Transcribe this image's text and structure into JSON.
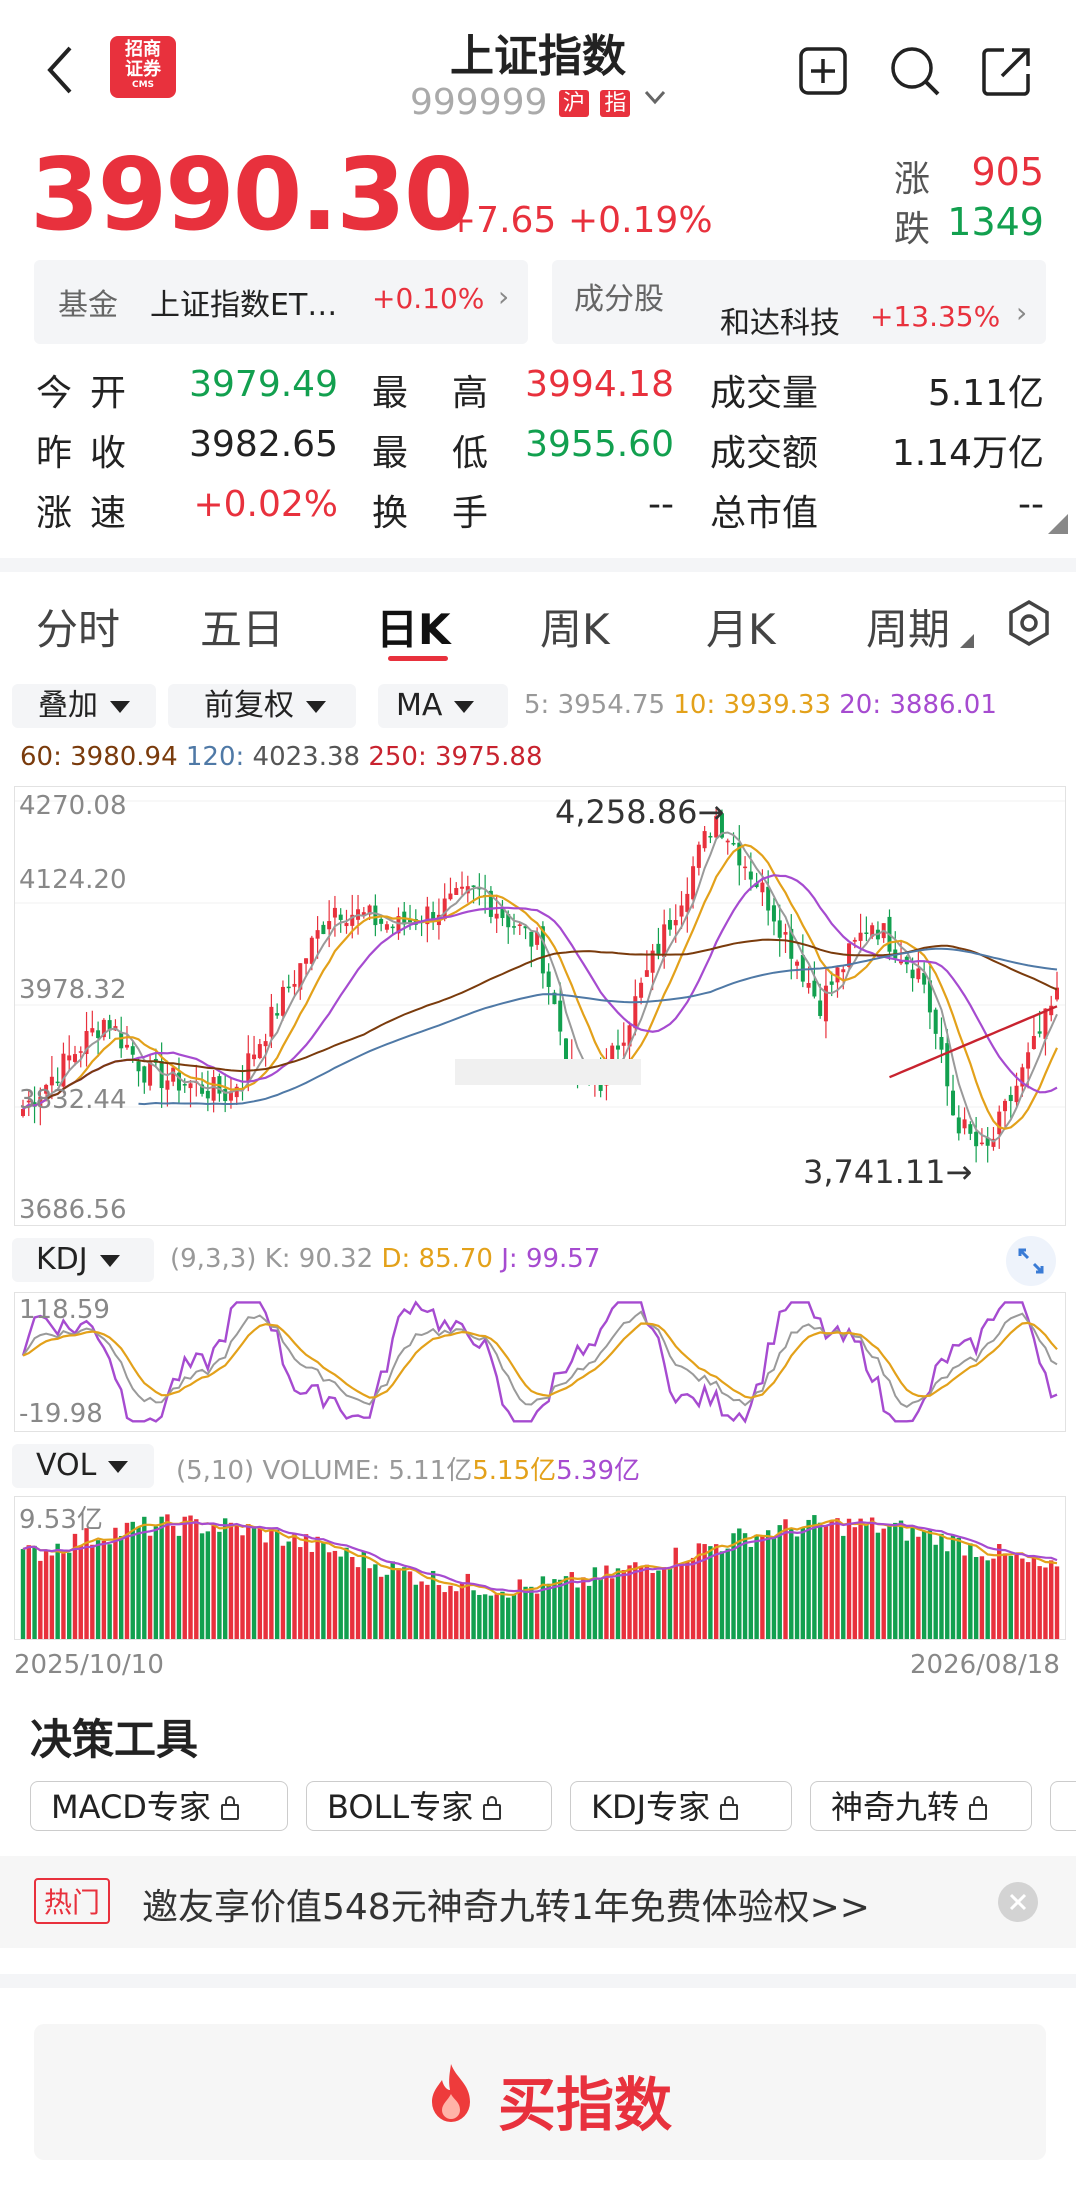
{
  "header": {
    "title": "上证指数",
    "code": "999999",
    "badge_market": "沪",
    "badge_type": "指",
    "logo_line1": "招商",
    "logo_line2": "证券",
    "logo_sub": "CMS"
  },
  "quote": {
    "price": "3990.30",
    "change": "+7.65",
    "change_pct": "+0.19%",
    "up_label": "涨",
    "up_count": "905",
    "down_label": "跌",
    "down_count": "1349"
  },
  "fund": {
    "label": "基金",
    "name": "上证指数ET…",
    "pct": "+0.10%"
  },
  "component": {
    "label": "成分股",
    "name": "和达科技",
    "pct": "+13.35%"
  },
  "stats": {
    "open_label": "今开",
    "open": "3979.49",
    "high_label": "最高",
    "high": "3994.18",
    "volume_label": "成交量",
    "volume": "5.11亿",
    "prev_label": "昨收",
    "prev": "3982.65",
    "low_label": "最低",
    "low": "3955.60",
    "amount_label": "成交额",
    "amount": "1.14万亿",
    "speed_label": "涨速",
    "speed": "+0.02%",
    "turnover_label": "换手",
    "turnover": "--",
    "mcap_label": "总市值",
    "mcap": "--"
  },
  "tabs": [
    "分时",
    "五日",
    "日K",
    "周K",
    "月K",
    "周期"
  ],
  "active_tab": "日K",
  "toolbar": {
    "overlay": "叠加",
    "adjust": "前复权",
    "indicator": "MA"
  },
  "ma": {
    "ma5": "5: 3954.75",
    "ma10": "10: 3939.33",
    "ma20": "20: 3886.01",
    "ma60": "60: 3980.94",
    "ma120_label": "120: ",
    "ma120": "4023.38",
    "ma250": "250: 3975.88"
  },
  "colors": {
    "red": "#e8313d",
    "green": "#12a04f",
    "ma5": "#9a9a9a",
    "ma10": "#e3a11a",
    "ma20": "#a64bd0",
    "ma60": "#7a3b0c",
    "ma120": "#4f79a6",
    "ma250": "#c8232f"
  },
  "kchart": {
    "y_labels": [
      "4270.08",
      "4124.20",
      "3978.32",
      "3832.44",
      "3686.56"
    ],
    "high_label": "4,258.86",
    "low_label": "3,741.11",
    "x_start": "2025/10/10",
    "x_end": "2026/08/18"
  },
  "kdj": {
    "name": "KDJ",
    "params": "(9,3,3)",
    "k": "K: 90.32",
    "d": "D: 85.70",
    "j": "J: 99.57",
    "y_top": "118.59",
    "y_bottom": "-19.98"
  },
  "vol": {
    "name": "VOL",
    "params": "(5,10)",
    "volume": "VOLUME: 5.11亿",
    "ma5": "5.15亿",
    "ma10": "5.39亿",
    "y_top": "9.53亿"
  },
  "tools": {
    "title": "决策工具",
    "items": [
      "MACD专家",
      "BOLL专家",
      "KDJ专家",
      "神奇九转"
    ]
  },
  "promo": {
    "tag": "热门",
    "text": "邀友享价值548元神奇九转1年免费体验权>>"
  },
  "buy": {
    "label": "买指数"
  }
}
